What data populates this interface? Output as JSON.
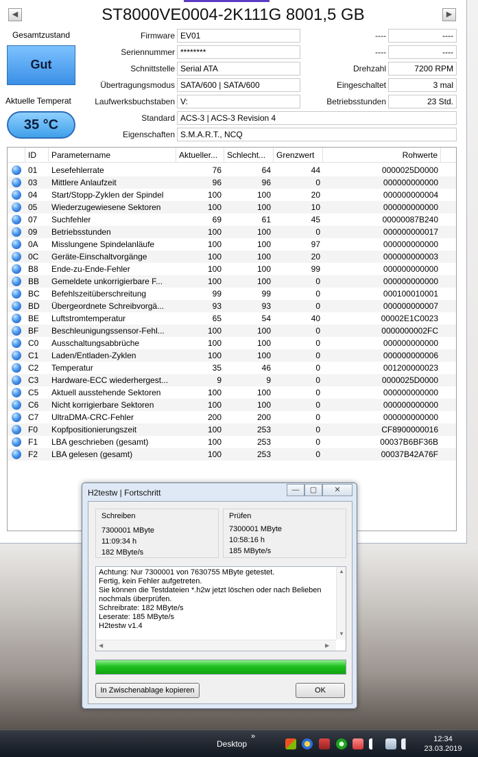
{
  "disk": {
    "title": "ST8000VE0004-2K111G 8001,5 GB",
    "prev_glyph": "◀",
    "next_glyph": "▶"
  },
  "status": {
    "label": "Gesamtzustand",
    "value": "Gut",
    "color": "#3a8fe6"
  },
  "temperature": {
    "label": "Aktuelle Temperat",
    "value": "35 °C"
  },
  "fields": {
    "firmware": {
      "label": "Firmware",
      "value": "EV01"
    },
    "serial": {
      "label": "Seriennummer",
      "value": "********"
    },
    "interface": {
      "label": "Schnittstelle",
      "value": "Serial ATA"
    },
    "transfer": {
      "label": "Übertragungsmodus",
      "value": "SATA/600 | SATA/600"
    },
    "drive_letters": {
      "label": "Laufwerksbuchstaben",
      "value": "V:"
    },
    "standard": {
      "label": "Standard",
      "value": "ACS-3 | ACS-3 Revision 4"
    },
    "features": {
      "label": "Eigenschaften",
      "value": "S.M.A.R.T., NCQ"
    },
    "blank1": {
      "label": "----",
      "value": "----"
    },
    "blank2": {
      "label": "----",
      "value": "----"
    },
    "rpm": {
      "label": "Drehzahl",
      "value": "7200 RPM"
    },
    "power_count": {
      "label": "Eingeschaltet",
      "value": "3 mal"
    },
    "power_hours": {
      "label": "Betriebsstunden",
      "value": "23 Std."
    }
  },
  "smart": {
    "columns": [
      "ID",
      "Parametername",
      "Aktueller...",
      "Schlecht...",
      "Grenzwert",
      "Rohwerte"
    ],
    "rows": [
      {
        "id": "01",
        "name": "Lesefehlerrate",
        "cur": "76",
        "worst": "64",
        "thr": "44",
        "raw": "0000025D0000"
      },
      {
        "id": "03",
        "name": "Mittlere Anlaufzeit",
        "cur": "96",
        "worst": "96",
        "thr": "0",
        "raw": "000000000000"
      },
      {
        "id": "04",
        "name": "Start/Stopp-Zyklen der Spindel",
        "cur": "100",
        "worst": "100",
        "thr": "20",
        "raw": "000000000004"
      },
      {
        "id": "05",
        "name": "Wiederzugewiesene Sektoren",
        "cur": "100",
        "worst": "100",
        "thr": "10",
        "raw": "000000000000"
      },
      {
        "id": "07",
        "name": "Suchfehler",
        "cur": "69",
        "worst": "61",
        "thr": "45",
        "raw": "00000087B240"
      },
      {
        "id": "09",
        "name": "Betriebsstunden",
        "cur": "100",
        "worst": "100",
        "thr": "0",
        "raw": "000000000017"
      },
      {
        "id": "0A",
        "name": "Misslungene Spindelanläufe",
        "cur": "100",
        "worst": "100",
        "thr": "97",
        "raw": "000000000000"
      },
      {
        "id": "0C",
        "name": "Geräte-Einschaltvorgänge",
        "cur": "100",
        "worst": "100",
        "thr": "20",
        "raw": "000000000003"
      },
      {
        "id": "B8",
        "name": "Ende-zu-Ende-Fehler",
        "cur": "100",
        "worst": "100",
        "thr": "99",
        "raw": "000000000000"
      },
      {
        "id": "BB",
        "name": "Gemeldete unkorrigierbare F...",
        "cur": "100",
        "worst": "100",
        "thr": "0",
        "raw": "000000000000"
      },
      {
        "id": "BC",
        "name": "Befehlszeitüberschreitung",
        "cur": "99",
        "worst": "99",
        "thr": "0",
        "raw": "000100010001"
      },
      {
        "id": "BD",
        "name": "Übergeordnete Schreibvorgä...",
        "cur": "93",
        "worst": "93",
        "thr": "0",
        "raw": "000000000007"
      },
      {
        "id": "BE",
        "name": "Luftstromtemperatur",
        "cur": "65",
        "worst": "54",
        "thr": "40",
        "raw": "00002E1C0023"
      },
      {
        "id": "BF",
        "name": "Beschleunigungssensor-Fehl...",
        "cur": "100",
        "worst": "100",
        "thr": "0",
        "raw": "0000000002FC"
      },
      {
        "id": "C0",
        "name": "Ausschaltungsabbrüche",
        "cur": "100",
        "worst": "100",
        "thr": "0",
        "raw": "000000000000"
      },
      {
        "id": "C1",
        "name": "Laden/Entladen-Zyklen",
        "cur": "100",
        "worst": "100",
        "thr": "0",
        "raw": "000000000006"
      },
      {
        "id": "C2",
        "name": "Temperatur",
        "cur": "35",
        "worst": "46",
        "thr": "0",
        "raw": "001200000023"
      },
      {
        "id": "C3",
        "name": "Hardware-ECC wiederhergest...",
        "cur": "9",
        "worst": "9",
        "thr": "0",
        "raw": "0000025D0000"
      },
      {
        "id": "C5",
        "name": "Aktuell ausstehende Sektoren",
        "cur": "100",
        "worst": "100",
        "thr": "0",
        "raw": "000000000000"
      },
      {
        "id": "C6",
        "name": "Nicht korrigierbare Sektoren",
        "cur": "100",
        "worst": "100",
        "thr": "0",
        "raw": "000000000000"
      },
      {
        "id": "C7",
        "name": "UltraDMA-CRC-Fehler",
        "cur": "200",
        "worst": "200",
        "thr": "0",
        "raw": "000000000000"
      },
      {
        "id": "F0",
        "name": "Kopfpositionierungszeit",
        "cur": "100",
        "worst": "253",
        "thr": "0",
        "raw": "CF8900000016"
      },
      {
        "id": "F1",
        "name": "LBA geschrieben (gesamt)",
        "cur": "100",
        "worst": "253",
        "thr": "0",
        "raw": "00037B6BF36B"
      },
      {
        "id": "F2",
        "name": "LBA gelesen (gesamt)",
        "cur": "100",
        "worst": "253",
        "thr": "0",
        "raw": "00037B42A76F"
      }
    ]
  },
  "dialog": {
    "title": "H2testw | Fortschritt",
    "min_glyph": "—",
    "max_glyph": "▢",
    "close_glyph": "✕",
    "write": {
      "title": "Schreiben",
      "size": "7300001 MByte",
      "time": "11:09:34 h",
      "speed": "182 MByte/s"
    },
    "verify": {
      "title": "Prüfen",
      "size": "7300001 MByte",
      "time": "10:58:16 h",
      "speed": "185 MByte/s"
    },
    "log_lines": [
      "Achtung: Nur 7300001 von 7630755 MByte getestet.",
      "Fertig, kein Fehler aufgetreten.",
      "Sie können die Testdateien *.h2w jetzt löschen oder nach Belieben",
      "nochmals überprüfen.",
      "Schreibrate: 182 MByte/s",
      "Leserate: 185 MByte/s",
      "H2testw v1.4"
    ],
    "progress": 1.0,
    "progress_color": "#18b818",
    "copy_button": "In Zwischenablage kopieren",
    "ok_button": "OK"
  },
  "taskbar": {
    "desktop_label": "Desktop",
    "chevron": "»",
    "time": "12:34",
    "date": "23.03.2019",
    "tray_icons": [
      "windows-flag-icon",
      "globe-antivirus-icon",
      "security-shield-icon",
      "green-update-icon",
      "sound-mixer-icon",
      "action-center-flag-icon",
      "network-icon",
      "volume-icon"
    ]
  }
}
